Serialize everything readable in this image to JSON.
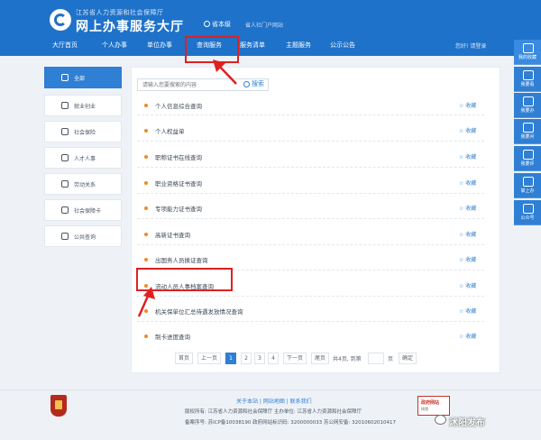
{
  "header": {
    "org_name": "江苏省人力资源和社会保障厅",
    "title": "网上办事服务大厅",
    "region": "省本级",
    "portal_link": "省人社门户网站",
    "user_links": "您好! 请登录"
  },
  "nav": {
    "items": [
      {
        "label": "大厅首页"
      },
      {
        "label": "个人办事"
      },
      {
        "label": "单位办事"
      },
      {
        "label": "查询服务"
      },
      {
        "label": "服务清单"
      },
      {
        "label": "主题服务"
      },
      {
        "label": "公示公告"
      }
    ],
    "active_index": 3
  },
  "sidebar": {
    "items": [
      {
        "label": "全部",
        "icon": "grid-icon"
      },
      {
        "label": "就业创业",
        "icon": "briefcase-icon"
      },
      {
        "label": "社会保险",
        "icon": "umbrella-icon"
      },
      {
        "label": "人才人事",
        "icon": "people-icon"
      },
      {
        "label": "劳动关系",
        "icon": "handshake-icon"
      },
      {
        "label": "社会保障卡",
        "icon": "card-icon"
      },
      {
        "label": "公共查询",
        "icon": "document-icon"
      }
    ]
  },
  "search": {
    "placeholder": "请输入您要搜索的内容",
    "button_label": "搜索"
  },
  "services": [
    {
      "label": "个人信息综合查询",
      "fav": "收藏"
    },
    {
      "label": "个人权益单",
      "fav": "收藏"
    },
    {
      "label": "职称证书在线查询",
      "fav": "收藏"
    },
    {
      "label": "职业资格证书查询",
      "fav": "收藏"
    },
    {
      "label": "专项能力证书查询",
      "fav": "收藏"
    },
    {
      "label": "高新证书查询",
      "fav": "收藏"
    },
    {
      "label": "出国务人员换证查询",
      "fav": "收藏"
    },
    {
      "label": "流动人员人事档案查询",
      "fav": "收藏"
    },
    {
      "label": "机关保单位汇总待遇发放情况查询",
      "fav": "收藏"
    },
    {
      "label": "制卡进度查询",
      "fav": "收藏"
    }
  ],
  "pagination": {
    "first": "首页",
    "prev": "上一页",
    "pages": [
      "1",
      "2",
      "3",
      "4"
    ],
    "current": "1",
    "next": "下一页",
    "last": "尾页",
    "summary": "共4页, 到第",
    "page_unit": "页",
    "confirm": "确定"
  },
  "footer": {
    "links": "关于本站  |  网站地图  |  联系我们",
    "line1": "版权所有: 江苏省人力资源和社会保障厅    主办单位: 江苏省人力资源和社会保障厅",
    "line2": "备案序号: 苏ICP备10038190    政府网站标识码: 3200000033    苏公网安备: 32010602010417",
    "gov_badge_title": "政府网站",
    "gov_badge_sub": "找错",
    "watermark": "沭阳发布"
  },
  "floatbar": {
    "items": [
      "我的收藏",
      "我要看",
      "我要办",
      "我要问",
      "我要评",
      "掌上办",
      "公众号"
    ]
  },
  "colors": {
    "header_blue": "#1f72c9",
    "accent": "#2f7fd4",
    "highlight_red": "#e02020",
    "dot_orange": "#f08a24"
  }
}
